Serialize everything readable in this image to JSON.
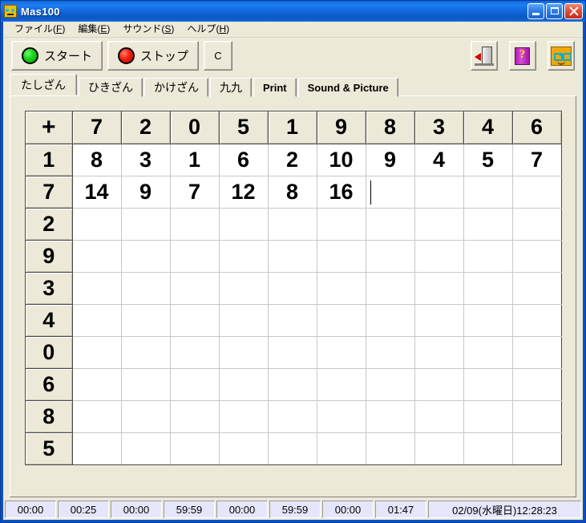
{
  "window": {
    "title": "Mas100",
    "icon": "app-face-icon",
    "buttons": {
      "minimize": "minimize-icon",
      "maximize": "maximize-icon",
      "close": "close-icon"
    }
  },
  "menubar": [
    {
      "label": "ファイル",
      "accel": "F"
    },
    {
      "label": "編集",
      "accel": "E"
    },
    {
      "label": "サウンド",
      "accel": "S"
    },
    {
      "label": "ヘルプ",
      "accel": "H"
    }
  ],
  "toolbar": {
    "start_label": "スタート",
    "stop_label": "ストップ",
    "clear_label": "C",
    "start_lamp_color": "#16d016",
    "stop_lamp_color": "#ef2010",
    "exit_icon": "exit-door-icon",
    "help_icon": "help-book-icon",
    "about_icon": "about-face-icon"
  },
  "tabs": [
    {
      "label": "たしざん",
      "active": true
    },
    {
      "label": "ひきざん",
      "active": false
    },
    {
      "label": "かけざん",
      "active": false
    },
    {
      "label": "九九",
      "active": false
    },
    {
      "label": "Print",
      "active": false
    },
    {
      "label": "Sound & Picture",
      "active": false
    }
  ],
  "grid": {
    "operator": "+",
    "columns": [
      7,
      2,
      0,
      5,
      1,
      9,
      8,
      3,
      4,
      6
    ],
    "rows": [
      1,
      7,
      2,
      9,
      3,
      4,
      0,
      6,
      8,
      5
    ],
    "cells": [
      [
        "8",
        "3",
        "1",
        "6",
        "2",
        "10",
        "9",
        "4",
        "5",
        "7"
      ],
      [
        "14",
        "9",
        "7",
        "12",
        "8",
        "16",
        "",
        "",
        "",
        ""
      ],
      [
        "",
        "",
        "",
        "",
        "",
        "",
        "",
        "",
        "",
        ""
      ],
      [
        "",
        "",
        "",
        "",
        "",
        "",
        "",
        "",
        "",
        ""
      ],
      [
        "",
        "",
        "",
        "",
        "",
        "",
        "",
        "",
        "",
        ""
      ],
      [
        "",
        "",
        "",
        "",
        "",
        "",
        "",
        "",
        "",
        ""
      ],
      [
        "",
        "",
        "",
        "",
        "",
        "",
        "",
        "",
        "",
        ""
      ],
      [
        "",
        "",
        "",
        "",
        "",
        "",
        "",
        "",
        "",
        ""
      ],
      [
        "",
        "",
        "",
        "",
        "",
        "",
        "",
        "",
        "",
        ""
      ],
      [
        "",
        "",
        "",
        "",
        "",
        "",
        "",
        "",
        "",
        ""
      ]
    ],
    "caret": {
      "row": 1,
      "col": 6
    }
  },
  "statusbar": {
    "cells": [
      "00:00",
      "00:25",
      "00:00",
      "59:59",
      "00:00",
      "59:59",
      "00:00",
      "01:47"
    ],
    "datetime": "02/09(水曜日)12:28:23"
  },
  "colors": {
    "titlebar": "#1268dc",
    "face": "#ece9d8",
    "grid_header": "#ece9d8",
    "status_cell": "#e6e6fa",
    "window_border": "#0a53c4"
  }
}
